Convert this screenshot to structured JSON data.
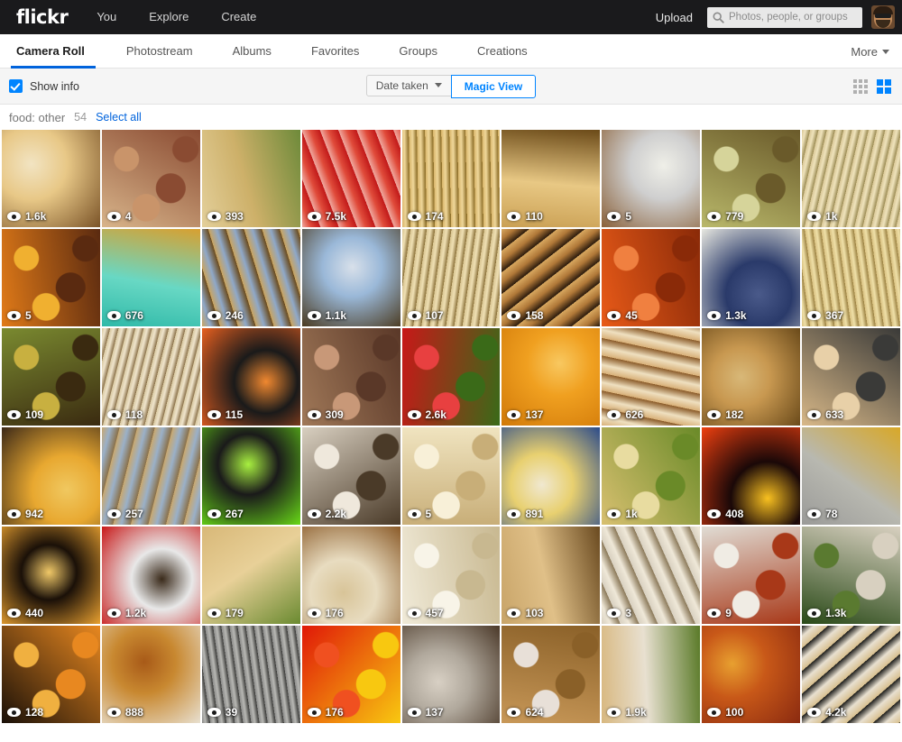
{
  "header": {
    "logo": "flickr",
    "nav": [
      {
        "label": "You"
      },
      {
        "label": "Explore"
      },
      {
        "label": "Create"
      }
    ],
    "upload_label": "Upload",
    "search_placeholder": "Photos, people, or groups",
    "search_value": "",
    "search_icon": "search-icon",
    "avatar_icon": "user-avatar"
  },
  "tabs": [
    {
      "label": "Camera Roll",
      "active": true
    },
    {
      "label": "Photostream",
      "active": false
    },
    {
      "label": "Albums",
      "active": false
    },
    {
      "label": "Favorites",
      "active": false
    },
    {
      "label": "Groups",
      "active": false
    },
    {
      "label": "Creations",
      "active": false
    }
  ],
  "more_label": "More",
  "toolbar": {
    "show_info_label": "Show info",
    "show_info_checked": true,
    "sort_label": "Date taken",
    "magic_view_label": "Magic View",
    "magic_view_active": true,
    "small_grid_icon": "small-grid-icon",
    "large_grid_icon": "large-grid-icon",
    "large_grid_active": true
  },
  "section": {
    "title": "food: other",
    "count": "54",
    "select_all_label": "Select all"
  },
  "colors": {
    "accent": "#0063dc",
    "accent_light": "#0084ff",
    "header_bg": "#1a1a1c",
    "toolbar_bg": "#f5f5f5"
  },
  "photos": [
    {
      "views": "1.6k",
      "c1": "#e8c887",
      "c2": "#7a5328",
      "c3": "#f2e4c2",
      "style": "radial"
    },
    {
      "views": "4",
      "c1": "#d8b48a",
      "c2": "#8a4b32",
      "c3": "#c9946a",
      "style": "blobs"
    },
    {
      "views": "393",
      "c1": "#e3cf9a",
      "c2": "#6e8a3a",
      "c3": "#cdb069",
      "style": "diag"
    },
    {
      "views": "7.5k",
      "c1": "#f0a9a0",
      "c2": "#c01818",
      "c3": "#e04b3a",
      "style": "rows"
    },
    {
      "views": "174",
      "c1": "#d8b56a",
      "c2": "#8a6b24",
      "c3": "#efd79a",
      "style": "streak"
    },
    {
      "views": "110",
      "c1": "#caa054",
      "c2": "#6b4a18",
      "c3": "#e8c884",
      "style": "diag"
    },
    {
      "views": "5",
      "c1": "#cfcfcf",
      "c2": "#8a6038",
      "c3": "#efefe8",
      "style": "radial"
    },
    {
      "views": "779",
      "c1": "#b9b86a",
      "c2": "#6a5a2a",
      "c3": "#d6d49a",
      "style": "blobs"
    },
    {
      "views": "1k",
      "c1": "#d9c796",
      "c2": "#9a8a52",
      "c3": "#efe3bc",
      "style": "streak"
    },
    {
      "views": "5",
      "c1": "#e07a18",
      "c2": "#5a2a10",
      "c3": "#f0b030",
      "style": "blobs"
    },
    {
      "views": "676",
      "c1": "#2fb9a8",
      "c2": "#d8a030",
      "c3": "#68d8c4",
      "style": "diag"
    },
    {
      "views": "246",
      "c1": "#c9a460",
      "c2": "#6a4a1c",
      "c3": "#8fa8c8",
      "style": "rows"
    },
    {
      "views": "1.1k",
      "c1": "#9ab8d8",
      "c2": "#4a3a20",
      "c3": "#d8e0ea",
      "style": "radial"
    },
    {
      "views": "107",
      "c1": "#d8c490",
      "c2": "#8a7038",
      "c3": "#efe0b4",
      "style": "streak"
    },
    {
      "views": "158",
      "c1": "#d8a860",
      "c2": "#2a1a0c",
      "c3": "#b07838",
      "style": "rows"
    },
    {
      "views": "45",
      "c1": "#e85a18",
      "c2": "#8a2a08",
      "c3": "#f08040",
      "style": "blobs"
    },
    {
      "views": "1.3k",
      "c1": "#2a3a6a",
      "c2": "#e8e8e0",
      "c3": "#4a5a8a",
      "style": "radial"
    },
    {
      "views": "367",
      "c1": "#d8c080",
      "c2": "#9a8040",
      "c3": "#efe0a8",
      "style": "streak"
    },
    {
      "views": "109",
      "c1": "#7a8a30",
      "c2": "#3a2a10",
      "c3": "#c8b040",
      "style": "blobs"
    },
    {
      "views": "118",
      "c1": "#d8c8a0",
      "c2": "#8a7048",
      "c3": "#efe4cc",
      "style": "streak"
    },
    {
      "views": "115",
      "c1": "#1a1a1a",
      "c2": "#e86020",
      "c3": "#f08830",
      "style": "radial"
    },
    {
      "views": "309",
      "c1": "#a07858",
      "c2": "#5a3828",
      "c3": "#c89878",
      "style": "blobs"
    },
    {
      "views": "2.6k",
      "c1": "#c81818",
      "c2": "#3a6a18",
      "c3": "#e84040",
      "style": "blobs"
    },
    {
      "views": "137",
      "c1": "#f0a020",
      "c2": "#d07808",
      "c3": "#f8c860",
      "style": "radial"
    },
    {
      "views": "626",
      "c1": "#d8b078",
      "c2": "#8a5a28",
      "c3": "#efe0c0",
      "style": "rows"
    },
    {
      "views": "182",
      "c1": "#c89850",
      "c2": "#6a4a1a",
      "c3": "#d8b878",
      "style": "radial"
    },
    {
      "views": "633",
      "c1": "#d8b888",
      "c2": "#3a3a38",
      "c3": "#e8d0a8",
      "style": "blobs"
    },
    {
      "views": "942",
      "c1": "#e8a830",
      "c2": "#3a2818",
      "c3": "#f0c860",
      "style": "radial"
    },
    {
      "views": "257",
      "c1": "#c8a870",
      "c2": "#8a7048",
      "c3": "#9ab0c8",
      "style": "rows"
    },
    {
      "views": "267",
      "c1": "#1a1a1a",
      "c2": "#68d818",
      "c3": "#a8f040",
      "style": "radial"
    },
    {
      "views": "2.2k",
      "c1": "#d8cfc0",
      "c2": "#4a3a28",
      "c3": "#efe8dc",
      "style": "blobs"
    },
    {
      "views": "5",
      "c1": "#f0e4c0",
      "c2": "#c8ae78",
      "c3": "#f8f0d8",
      "style": "blobs"
    },
    {
      "views": "891",
      "c1": "#e8d070",
      "c2": "#2a4a8a",
      "c3": "#f0e8d0",
      "style": "radial"
    },
    {
      "views": "1k",
      "c1": "#d8c070",
      "c2": "#6a8a28",
      "c3": "#e8dca0",
      "style": "blobs"
    },
    {
      "views": "408",
      "c1": "#1a0808",
      "c2": "#f04010",
      "c3": "#f8c020",
      "style": "radial"
    },
    {
      "views": "78",
      "c1": "#9a9a98",
      "c2": "#d8a828",
      "c3": "#b8b8b0",
      "style": "diag"
    },
    {
      "views": "440",
      "c1": "#1a1008",
      "c2": "#e8a030",
      "c3": "#f0c868",
      "style": "radial"
    },
    {
      "views": "1.2k",
      "c1": "#e8e8e8",
      "c2": "#c81818",
      "c3": "#3a2a1a",
      "style": "radial"
    },
    {
      "views": "179",
      "c1": "#d8b878",
      "c2": "#6a8a30",
      "c3": "#e8d098",
      "style": "diag"
    },
    {
      "views": "176",
      "c1": "#e8dcc0",
      "c2": "#8a5a28",
      "c3": "#d8c498",
      "style": "radial"
    },
    {
      "views": "457",
      "c1": "#f0ead8",
      "c2": "#c8b890",
      "c3": "#f8f4e8",
      "style": "blobs"
    },
    {
      "views": "103",
      "c1": "#c8a468",
      "c2": "#6a4a20",
      "c3": "#e0c088",
      "style": "diag"
    },
    {
      "views": "3",
      "c1": "#d8d0c0",
      "c2": "#8a7858",
      "c3": "#efe8d8",
      "style": "rows"
    },
    {
      "views": "9",
      "c1": "#e0dcd4",
      "c2": "#a83818",
      "c3": "#f0ece4",
      "style": "blobs"
    },
    {
      "views": "1.3k",
      "c1": "#2a4a18",
      "c2": "#d8d0c0",
      "c3": "#5a7a30",
      "style": "blobs"
    },
    {
      "views": "128",
      "c1": "#1a1008",
      "c2": "#e88820",
      "c3": "#f0b040",
      "style": "blobs"
    },
    {
      "views": "888",
      "c1": "#c88830",
      "c2": "#e8e0d0",
      "c3": "#a85a18",
      "style": "radial"
    },
    {
      "views": "39",
      "c1": "#8a8a88",
      "c2": "#3a3a38",
      "c3": "#b8b8b4",
      "style": "streak"
    },
    {
      "views": "176",
      "c1": "#e01808",
      "c2": "#f8c810",
      "c3": "#f05020",
      "style": "blobs"
    },
    {
      "views": "137",
      "c1": "#b0a89c",
      "c2": "#4a3828",
      "c3": "#d8d0c4",
      "style": "radial"
    },
    {
      "views": "624",
      "c1": "#c89858",
      "c2": "#8a6028",
      "c3": "#e8e0d8",
      "style": "blobs"
    },
    {
      "views": "1.9k",
      "c1": "#d8b880",
      "c2": "#5a7a28",
      "c3": "#e8e0d0",
      "style": "diag"
    },
    {
      "views": "100",
      "c1": "#c85818",
      "c2": "#8a2a10",
      "c3": "#e8a030",
      "style": "radial"
    },
    {
      "views": "4.2k",
      "c1": "#1a1a18",
      "c2": "#d8c090",
      "c3": "#e8e0d0",
      "style": "rows"
    }
  ]
}
